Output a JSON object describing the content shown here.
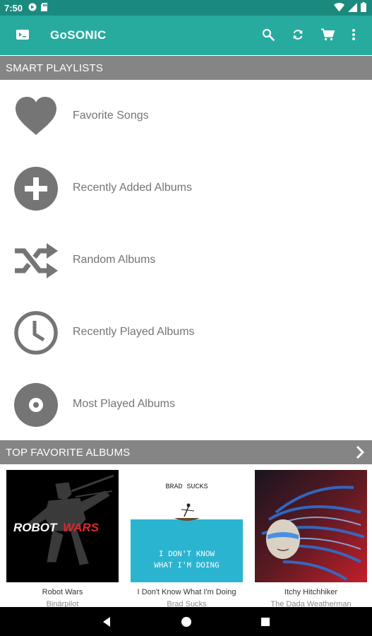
{
  "status_bar": {
    "time": "7:50",
    "left_icons": [
      "gosonic-notification-icon",
      "sd-card-icon"
    ],
    "right_icons": [
      "wifi-icon",
      "signal-icon",
      "battery-icon"
    ]
  },
  "app_bar": {
    "title": "GoSONIC",
    "nav_icon": "now-playing-icon",
    "actions": [
      "search-icon",
      "refresh-icon",
      "cart-icon",
      "more-vert-icon"
    ],
    "background": "#27ab9e",
    "status_background": "#1a8a7f"
  },
  "smart_playlists": {
    "header": "SMART PLAYLISTS",
    "items": [
      {
        "label": "Favorite Songs",
        "icon": "heart-icon"
      },
      {
        "label": "Recently Added Albums",
        "icon": "add-circle-icon"
      },
      {
        "label": "Random Albums",
        "icon": "shuffle-icon"
      },
      {
        "label": "Recently Played Albums",
        "icon": "clock-icon"
      },
      {
        "label": "Most Played Albums",
        "icon": "disc-icon"
      }
    ]
  },
  "top_favorites": {
    "header": "TOP FAVORITE ALBUMS",
    "albums": [
      {
        "title": "Robot Wars",
        "artist": "Binärpilot",
        "cover_text_a": "ROBOT",
        "cover_text_b": "WARS"
      },
      {
        "title": "I Don't Know What I'm Doing",
        "artist": "Brad Sucks",
        "cover_text_a": "BRAD SUCKS",
        "cover_text_b": "I DON'T KNOW",
        "cover_text_c": "WHAT I'M DOING"
      },
      {
        "title": "Itchy Hitchhiker",
        "artist": "The Dada Weatherman"
      }
    ]
  },
  "nav_bar": {
    "buttons": [
      "back-icon",
      "home-icon",
      "recents-icon"
    ]
  },
  "colors": {
    "section_header": "#858585",
    "icon_gray": "#757575"
  }
}
